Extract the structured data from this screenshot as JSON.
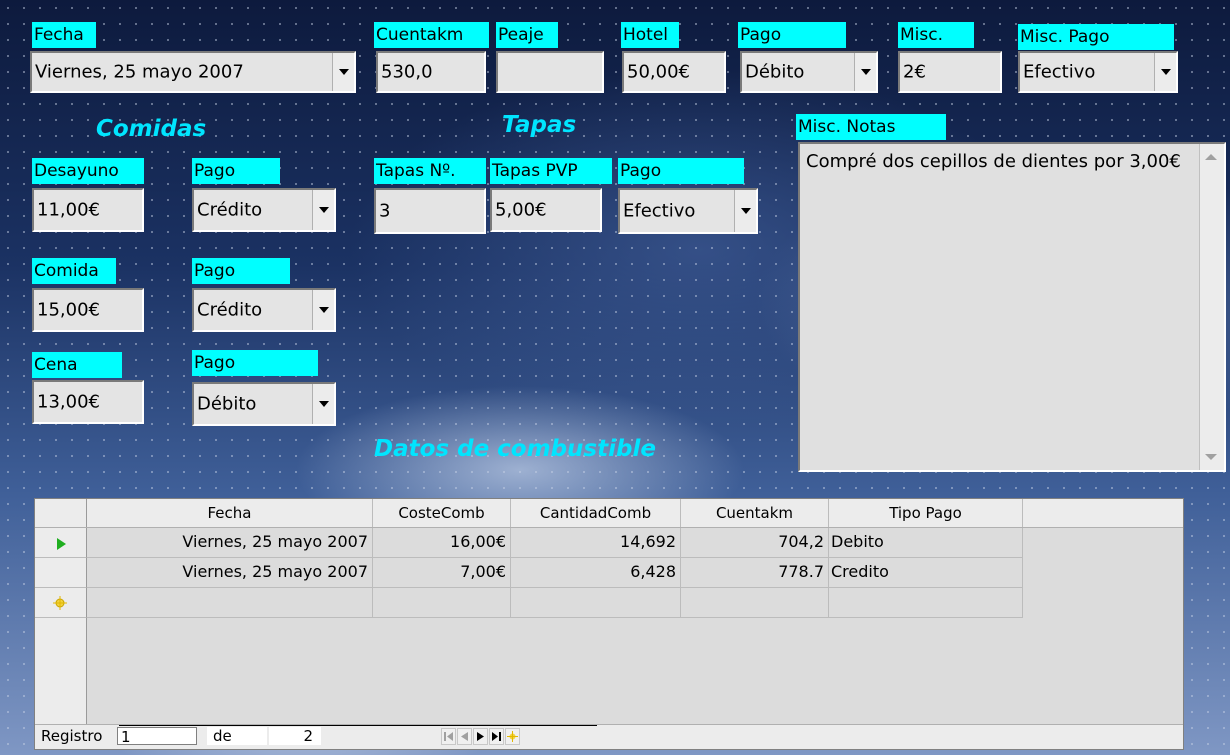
{
  "header": {
    "fecha_label": "Fecha",
    "fecha_value": "Viernes, 25 mayo 2007",
    "cuentakm_label": "Cuentakm",
    "cuentakm_value": "530,0",
    "peaje_label": "Peaje",
    "peaje_value": "",
    "hotel_label": "Hotel",
    "hotel_value": "50,00€",
    "pago_label": "Pago",
    "pago_value": "Débito",
    "misc_label": "Misc.",
    "misc_value": "2€",
    "misc_pago_label": "Misc. Pago",
    "misc_pago_value": "Efectivo"
  },
  "comidas": {
    "title": "Comidas",
    "desayuno_label": "Desayuno",
    "desayuno_value": "11,00€",
    "desayuno_pago_label": "Pago",
    "desayuno_pago_value": "Crédito",
    "comida_label": "Comida",
    "comida_value": "15,00€",
    "comida_pago_label": "Pago",
    "comida_pago_value": "Crédito",
    "cena_label": "Cena",
    "cena_value": "13,00€",
    "cena_pago_label": "Pago",
    "cena_pago_value": "Débito"
  },
  "tapas": {
    "title": "Tapas",
    "num_label": "Tapas Nº.",
    "num_value": "3",
    "pvp_label": "Tapas PVP",
    "pvp_value": "5,00€",
    "pago_label": "Pago",
    "pago_value": "Efectivo"
  },
  "notes": {
    "label": "Misc. Notas",
    "text": "Compré dos cepillos de dientes por 3,00€"
  },
  "fuel": {
    "title": "Datos de combustible",
    "columns": [
      "Fecha",
      "CosteComb",
      "CantidadComb",
      "Cuentakm",
      "Tipo Pago"
    ],
    "rows": [
      [
        "Viernes, 25 mayo 2007",
        "16,00€",
        "14,692",
        "704,2",
        "Debito"
      ],
      [
        "Viernes, 25 mayo 2007",
        "7,00€",
        "6,428",
        "778.7",
        "Credito"
      ]
    ],
    "nav": {
      "registro_label": "Registro",
      "registro_value": "1",
      "de_label": "de",
      "total": "2"
    }
  }
}
